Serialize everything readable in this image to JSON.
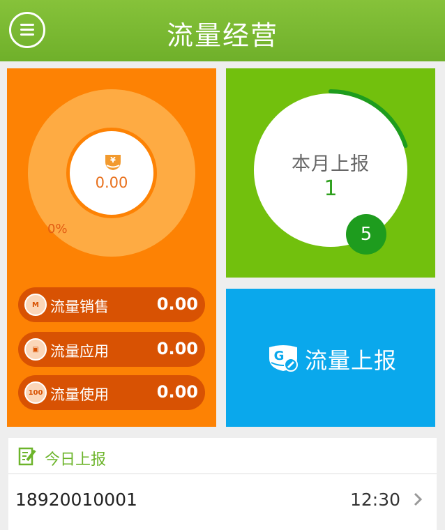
{
  "header": {
    "title": "流量经营",
    "menu_icon": "hamburger-menu-icon"
  },
  "summary": {
    "amount": "0.00",
    "percent": "0%",
    "money_icon": "yen-coin-icon",
    "stats": [
      {
        "label": "流量销售",
        "value": "0.00",
        "icon": "m-badge-icon"
      },
      {
        "label": "流量应用",
        "value": "0.00",
        "icon": "card-icon"
      },
      {
        "label": "流量使用",
        "value": "0.00",
        "icon": "coin-100-icon"
      }
    ]
  },
  "monthly": {
    "label": "本月上报",
    "count": "1",
    "target": "5",
    "progress_fraction": 0.2
  },
  "report_button": {
    "label": "流量上报",
    "icon": "g-edit-icon"
  },
  "today": {
    "title": "今日上报",
    "icon": "edit-note-icon",
    "rows": [
      {
        "phone": "18920010001",
        "time": "12:30"
      }
    ]
  },
  "colors": {
    "header": "#7aba30",
    "orange": "#fd8204",
    "green": "#72c00d",
    "blue": "#0aa8ec",
    "progress": "#1e9c1e"
  }
}
